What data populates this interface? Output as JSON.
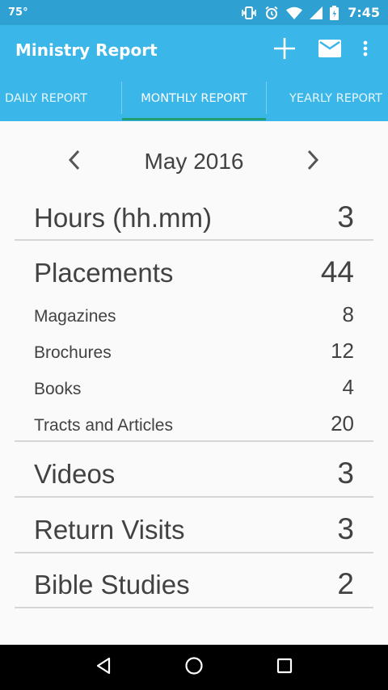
{
  "status_bar": {
    "temperature": "75°",
    "time": "7:45",
    "icons": [
      "vibrate-icon",
      "alarm-icon",
      "wifi-icon",
      "signal-icon",
      "battery-icon"
    ]
  },
  "app_bar": {
    "title": "Ministry Report",
    "actions": [
      "plus-icon",
      "mail-icon",
      "more-vert-icon"
    ]
  },
  "tabs": [
    {
      "label": "DAILY REPORT",
      "active": false
    },
    {
      "label": "MONTHLY REPORT",
      "active": true
    },
    {
      "label": "YEARLY REPORT",
      "active": false
    }
  ],
  "month_nav": {
    "label": "May 2016",
    "prev_icon": "chevron-left-icon",
    "next_icon": "chevron-right-icon"
  },
  "report": {
    "hours": {
      "label": "Hours (hh.mm)",
      "value": "3"
    },
    "placements": {
      "label": "Placements",
      "value": "44"
    },
    "magazines": {
      "label": "Magazines",
      "value": "8"
    },
    "brochures": {
      "label": "Brochures",
      "value": "12"
    },
    "books": {
      "label": "Books",
      "value": "4"
    },
    "tracts": {
      "label": "Tracts and Articles",
      "value": "20"
    },
    "videos": {
      "label": "Videos",
      "value": "3"
    },
    "return_visits": {
      "label": "Return Visits",
      "value": "3"
    },
    "bible_studies": {
      "label": "Bible Studies",
      "value": "2"
    }
  },
  "nav_bar": {
    "buttons": [
      "back-icon",
      "home-icon",
      "recents-icon"
    ]
  },
  "colors": {
    "status_bar": "#2FA0D2",
    "app_bar": "#3BB6E8",
    "tab_indicator": "#219C73",
    "text": "#424242"
  }
}
